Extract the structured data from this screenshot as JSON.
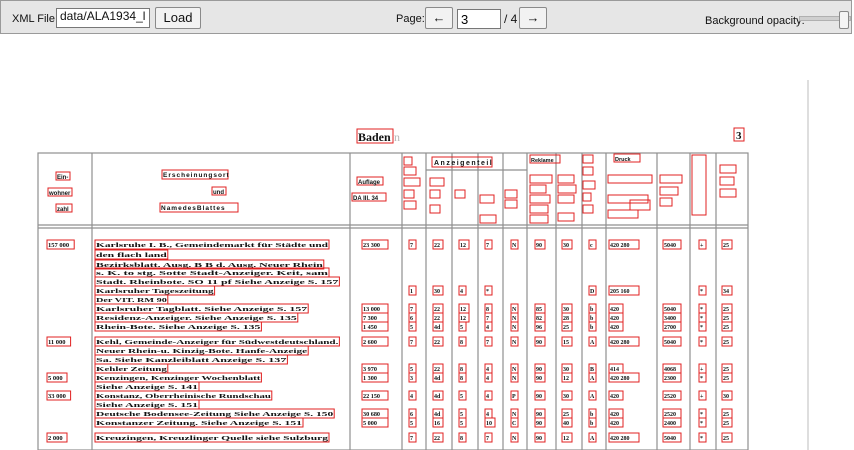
{
  "toolbar": {
    "xml_file_label": "XML File:",
    "xml_file_value": "data/ALA1934_l",
    "load_label": "Load",
    "page_label": "Page:",
    "prev_label": "←",
    "page_value": "3",
    "page_total": "/ 4",
    "next_label": "→",
    "opacity_label": "Background opacity:"
  },
  "document": {
    "title": "Baden",
    "title_ghost": "n",
    "page_number": "3",
    "header": {
      "col1": [
        "Ein-",
        "wohner",
        "zahl"
      ],
      "col2": [
        "Erscheinungsort",
        "und",
        "NamedesBlattes"
      ],
      "col3": [
        "Auflage",
        "DA III. 34"
      ],
      "anzeigenteil": "Anzeigenteil",
      "reklame": "Reklame",
      "druck": "Druck"
    },
    "rows": [
      {
        "ew": "157 000",
        "text": "Karlsruhe I. B., Gemeindemarkt für Städte und",
        "aufl": "23 300",
        "c": [
          "7",
          "22",
          "12",
          "7",
          "N",
          "90",
          "30",
          "c",
          "420 280",
          "5040",
          "+",
          "25"
        ]
      },
      {
        "ew": "",
        "text": "den flach land",
        "aufl": "",
        "c": [
          "",
          "",
          "",
          "",
          "",
          "",
          "",
          "",
          "",
          "",
          "",
          ""
        ]
      },
      {
        "ew": "",
        "text": "Bezirksblatt. Ausg. B B d. Ausg. Neuer Rhein",
        "aufl": "",
        "c": [
          "",
          "",
          "",
          "",
          "",
          "",
          "",
          "",
          "",
          "",
          "",
          ""
        ]
      },
      {
        "ew": "",
        "text": "s. K. to stg. Sotte Stadt-Anzeiger. Keit, sam",
        "aufl": "",
        "c": [
          "",
          "",
          "",
          "",
          "",
          "",
          "",
          "",
          "",
          "",
          "",
          ""
        ]
      },
      {
        "ew": "",
        "text": "Stadt. Rheinbote. SO 11 pf Siehe Anzeige S. 157",
        "aufl": "",
        "c": [
          "",
          "",
          "",
          "",
          "",
          "",
          "",
          "",
          "",
          "",
          "",
          ""
        ]
      },
      {
        "ew": "",
        "text": "Karlsruher Tageszeitung",
        "aufl": "",
        "c": [
          "1",
          "30",
          "4",
          "*",
          "",
          "",
          "",
          "D",
          "205 160",
          "",
          "*",
          "34"
        ]
      },
      {
        "ew": "",
        "text": "Der VIT. RM 90",
        "aufl": "",
        "c": [
          "",
          "",
          "",
          "",
          "",
          "",
          "",
          "",
          "",
          "",
          "",
          ""
        ]
      },
      {
        "ew": "",
        "text": "Karlsruher Tagblatt. Siehe Anzeige S. 157",
        "aufl": "13 000",
        "c": [
          "7",
          "22",
          "12",
          "8",
          "N",
          "85",
          "30",
          "b",
          "420",
          "5040",
          "*",
          "25"
        ]
      },
      {
        "ew": "",
        "text": "Residenz-Anzeiger. Siehe Anzeige S. 135",
        "aufl": "7 300",
        "c": [
          "6",
          "22",
          "12",
          "7",
          "N",
          "82",
          "28",
          "b",
          "420",
          "3400",
          "*",
          "25"
        ]
      },
      {
        "ew": "",
        "text": "Rhein-Bote. Siehe Anzeige S. 135",
        "aufl": "1 450",
        "c": [
          "5",
          "4d",
          "5",
          "4",
          "N",
          "96",
          "25",
          "b",
          "420",
          "2700",
          "*",
          "25"
        ]
      },
      {
        "ew": "11 000",
        "text": "Kehl, Gemeinde-Anzeiger für Südwestdeutschland.",
        "aufl": "2 600",
        "c": [
          "7",
          "22",
          "8",
          "7",
          "N",
          "90",
          "15",
          "A",
          "420 280",
          "5040",
          "*",
          "25"
        ]
      },
      {
        "ew": "",
        "text": "Neuer Rhein-u. Kinzig-Bote. Hanfe-Anzeige",
        "aufl": "",
        "c": [
          "",
          "",
          "",
          "",
          "",
          "",
          "",
          "",
          "",
          "",
          "",
          ""
        ]
      },
      {
        "ew": "",
        "text": "Sa. Siehe Kanzleiblatt Anzeige S. 137",
        "aufl": "",
        "c": [
          "",
          "",
          "",
          "",
          "",
          "",
          "",
          "",
          "",
          "",
          "",
          ""
        ]
      },
      {
        "ew": "",
        "text": "Kehler Zeitung",
        "aufl": "3 970",
        "c": [
          "5",
          "22",
          "8",
          "4",
          "N",
          "90",
          "30",
          "B",
          "414",
          "4068",
          "+",
          "25"
        ]
      },
      {
        "ew": "5 000",
        "text": "Kenzingen, Kenzinger Wochenblatt",
        "aufl": "1 300",
        "c": [
          "3",
          "4d",
          "8",
          "4",
          "N",
          "90",
          "12",
          "A",
          "420 280",
          "2300",
          "*",
          "25"
        ]
      },
      {
        "ew": "",
        "text": "Siehe Anzeige S. 141",
        "aufl": "",
        "c": [
          "",
          "",
          "",
          "",
          "",
          "",
          "",
          "",
          "",
          "",
          "",
          ""
        ]
      },
      {
        "ew": "33 000",
        "text": "Konstanz, Oberrheinische Rundschau",
        "aufl": "22 150",
        "c": [
          "4",
          "4d",
          "5",
          "4",
          "P",
          "90",
          "30",
          "A",
          "420",
          "2520",
          "+",
          "30"
        ]
      },
      {
        "ew": "",
        "text": "Siehe Anzeige S. 151",
        "aufl": "",
        "c": [
          "",
          "",
          "",
          "",
          "",
          "",
          "",
          "",
          "",
          "",
          "",
          ""
        ]
      },
      {
        "ew": "",
        "text": "Deutsche Bodensee-Zeitung Siehe Anzeige S. 150",
        "aufl": "30 680",
        "c": [
          "6",
          "4d",
          "5",
          "4",
          "N",
          "90",
          "25",
          "b",
          "420",
          "2520",
          "*",
          "25"
        ]
      },
      {
        "ew": "",
        "text": "Konstanzer Zeitung. Siehe Anzeige S. 151",
        "aufl": "5 000",
        "c": [
          "5",
          "16",
          "5",
          "10",
          "C",
          "90",
          "40",
          "b",
          "420",
          "2400",
          "*",
          "25"
        ]
      },
      {
        "ew": "2 000",
        "text": "Kreuzingen, Kreuzlinger Quelle siehe Sulzburg",
        "aufl": "",
        "c": [
          "7",
          "22",
          "8",
          "7",
          "N",
          "90",
          "12",
          "A",
          "420 280",
          "5040",
          "*",
          "25"
        ]
      }
    ]
  }
}
